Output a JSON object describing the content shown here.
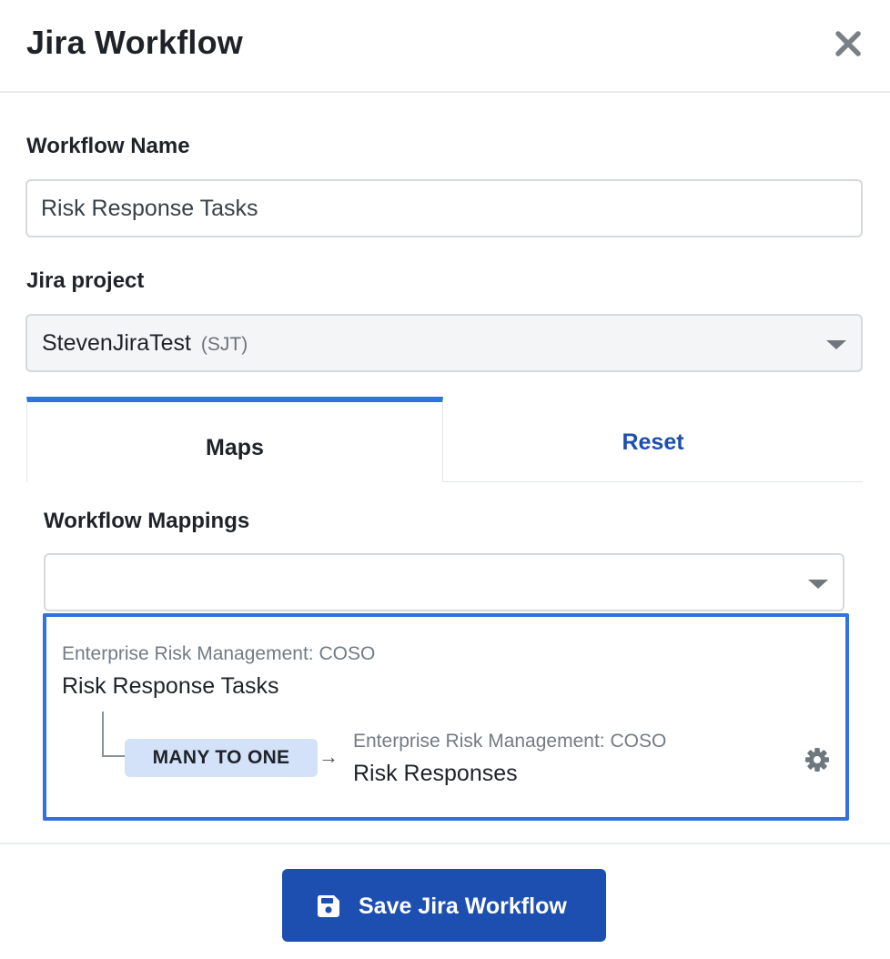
{
  "dialog": {
    "title": "Jira Workflow",
    "close_icon": "close-icon"
  },
  "form": {
    "workflow_name_label": "Workflow Name",
    "workflow_name_value": "Risk Response Tasks",
    "jira_project_label": "Jira project",
    "jira_project_value": "StevenJiraTest",
    "jira_project_key": "(SJT)"
  },
  "tabs": [
    {
      "label": "Maps",
      "active": true
    },
    {
      "label": "Reset",
      "active": false
    }
  ],
  "mappings": {
    "label": "Workflow Mappings",
    "select_value": "",
    "items": [
      {
        "source_category": "Enterprise Risk Management: COSO",
        "source_name": "Risk Response Tasks",
        "relation": "MANY TO ONE",
        "arrow": "→",
        "target_category": "Enterprise Risk Management: COSO",
        "target_name": "Risk Responses",
        "settings_icon": "gear-icon"
      }
    ]
  },
  "footer": {
    "save_label": "Save Jira Workflow",
    "save_icon": "floppy-disk-icon"
  },
  "colors": {
    "accent": "#2f72e0",
    "primary_button": "#1c4fb0",
    "badge_bg": "#d3e1f9"
  }
}
